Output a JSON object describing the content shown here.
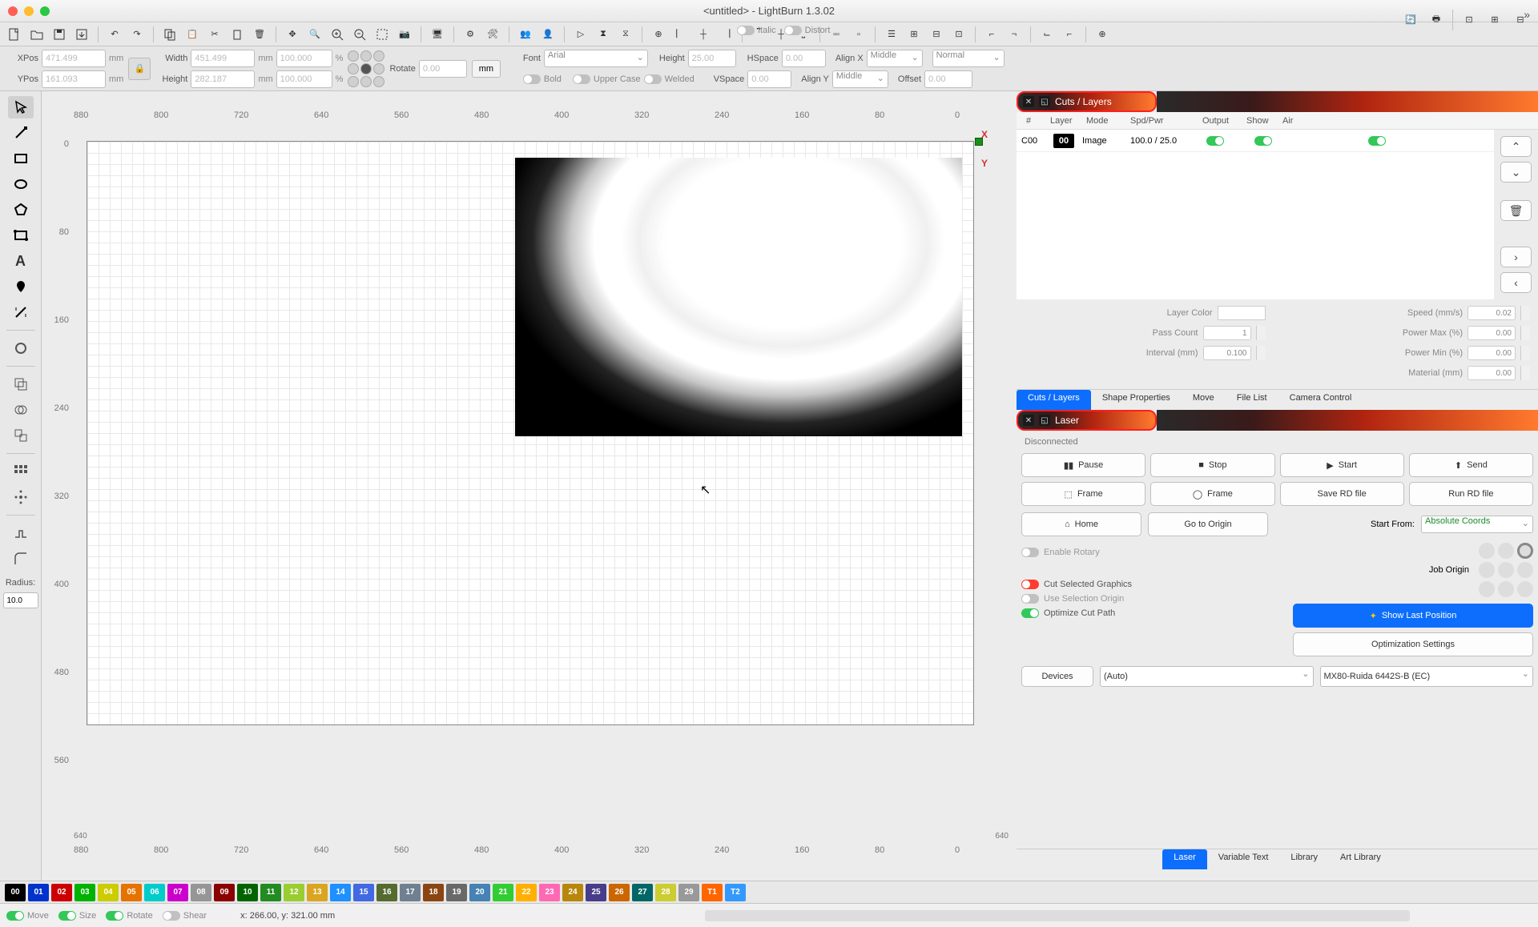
{
  "window_title": "<untitled> - LightBurn 1.3.02",
  "position": {
    "xpos_label": "XPos",
    "xpos": "471.499",
    "xpos_unit": "mm",
    "ypos_label": "YPos",
    "ypos": "161.093",
    "ypos_unit": "mm",
    "width_label": "Width",
    "width": "451.499",
    "width_unit": "mm",
    "width_pct": "100.000",
    "height_label": "Height",
    "height": "282.187",
    "height_unit": "mm",
    "height_pct": "100.000",
    "rotate_label": "Rotate",
    "rotate": "0.00",
    "mm_btn": "mm"
  },
  "fontbar": {
    "font_label": "Font",
    "font": "Arial",
    "height_label": "Height",
    "height": "25.00",
    "hspace_label": "HSpace",
    "hspace": "0.00",
    "vspace_label": "VSpace",
    "vspace": "0.00",
    "alignx_label": "Align X",
    "alignx": "Middle",
    "aligny_label": "Align Y",
    "aligny": "Middle",
    "normal": "Normal",
    "offset_label": "Offset",
    "offset": "0.00",
    "bold": "Bold",
    "italic": "Italic",
    "upper": "Upper Case",
    "welded": "Welded",
    "distort": "Distort"
  },
  "left_tools": {
    "radius_label": "Radius:",
    "radius": "10.0"
  },
  "ruler_top": [
    "880",
    "800",
    "720",
    "640",
    "560",
    "480",
    "400",
    "320",
    "240",
    "160",
    "80",
    "0"
  ],
  "ruler_left": [
    "0",
    "80",
    "160",
    "240",
    "320",
    "400",
    "480",
    "560"
  ],
  "ruler_bottom_upper": [
    "640",
    "640"
  ],
  "ruler_bottom": [
    "880",
    "800",
    "720",
    "640",
    "560",
    "480",
    "400",
    "320",
    "240",
    "160",
    "80",
    "0"
  ],
  "cuts_layers": {
    "title": "Cuts / Layers",
    "headers": [
      "#",
      "Layer",
      "Mode",
      "Spd/Pwr",
      "Output",
      "Show",
      "Air"
    ],
    "rows": [
      {
        "id": "C00",
        "layer": "00",
        "mode": "Image",
        "spdpwr": "100.0 / 25.0",
        "output": true,
        "show": true,
        "air": true
      }
    ],
    "props": {
      "layer_color": "Layer Color",
      "pass_count": "Pass Count",
      "pass_val": "1",
      "interval": "Interval (mm)",
      "interval_val": "0.100",
      "speed": "Speed (mm/s)",
      "speed_val": "0.02",
      "pmax": "Power Max (%)",
      "pmax_val": "0.00",
      "pmin": "Power Min (%)",
      "pmin_val": "0.00",
      "material": "Material (mm)",
      "material_val": "0.00"
    },
    "tabs": [
      "Cuts / Layers",
      "Shape Properties",
      "Move",
      "File List",
      "Camera Control"
    ]
  },
  "laser": {
    "title": "Laser",
    "status": "Disconnected",
    "pause": "Pause",
    "stop": "Stop",
    "start": "Start",
    "send": "Send",
    "frame": "Frame",
    "frame2": "Frame",
    "save_rd": "Save RD file",
    "run_rd": "Run RD file",
    "home": "Home",
    "goto": "Go to Origin",
    "start_from": "Start From:",
    "start_from_val": "Absolute Coords",
    "job_origin": "Job Origin",
    "enable_rotary": "Enable Rotary",
    "cut_sel": "Cut Selected Graphics",
    "use_sel": "Use Selection Origin",
    "opt_cut": "Optimize Cut Path",
    "show_last": "Show Last Position",
    "opt_set": "Optimization Settings",
    "devices": "Devices",
    "device_sel": "(Auto)",
    "machine": "MX80-Ruida 6442S-B (EC)"
  },
  "bottom_tabs": [
    "Laser",
    "Variable Text",
    "Library",
    "Art Library"
  ],
  "palette": [
    {
      "n": "00",
      "c": "#000000"
    },
    {
      "n": "01",
      "c": "#0033cc"
    },
    {
      "n": "02",
      "c": "#cc0000"
    },
    {
      "n": "03",
      "c": "#00b300"
    },
    {
      "n": "04",
      "c": "#cccc00"
    },
    {
      "n": "05",
      "c": "#e67300"
    },
    {
      "n": "06",
      "c": "#00cccc"
    },
    {
      "n": "07",
      "c": "#cc00cc"
    },
    {
      "n": "08",
      "c": "#969696"
    },
    {
      "n": "09",
      "c": "#8b0000"
    },
    {
      "n": "10",
      "c": "#006400"
    },
    {
      "n": "11",
      "c": "#228b22"
    },
    {
      "n": "12",
      "c": "#9acd32"
    },
    {
      "n": "13",
      "c": "#daa520"
    },
    {
      "n": "14",
      "c": "#1e90ff"
    },
    {
      "n": "15",
      "c": "#4169e1"
    },
    {
      "n": "16",
      "c": "#556b2f"
    },
    {
      "n": "17",
      "c": "#708090"
    },
    {
      "n": "18",
      "c": "#8b4513"
    },
    {
      "n": "19",
      "c": "#696969"
    },
    {
      "n": "20",
      "c": "#4682b4"
    },
    {
      "n": "21",
      "c": "#32cd32"
    },
    {
      "n": "22",
      "c": "#ffb000"
    },
    {
      "n": "23",
      "c": "#ff69b4"
    },
    {
      "n": "24",
      "c": "#b8860b"
    },
    {
      "n": "25",
      "c": "#483d8b"
    },
    {
      "n": "26",
      "c": "#cc6600"
    },
    {
      "n": "27",
      "c": "#006666"
    },
    {
      "n": "28",
      "c": "#cccc33"
    },
    {
      "n": "29",
      "c": "#999999"
    },
    {
      "n": "T1",
      "c": "#ff6600"
    },
    {
      "n": "T2",
      "c": "#3399ff"
    }
  ],
  "statusbar": {
    "move": "Move",
    "size": "Size",
    "rotate": "Rotate",
    "shear": "Shear",
    "coords": "x: 266.00, y: 321.00 mm"
  }
}
